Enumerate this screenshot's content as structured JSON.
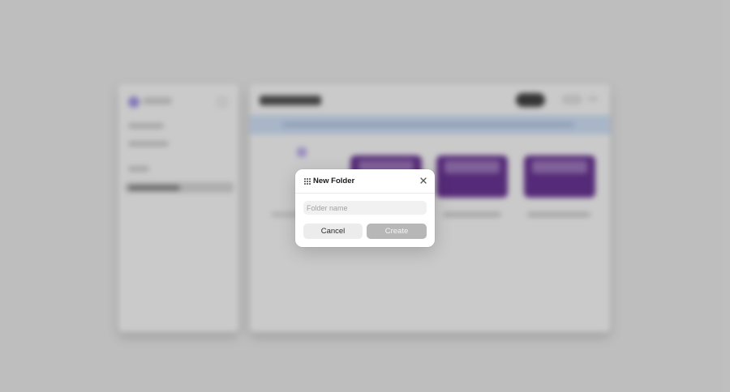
{
  "dialog": {
    "title": "New Folder",
    "input": {
      "placeholder": "Folder name",
      "value": ""
    },
    "cancel_label": "Cancel",
    "create_label": "Create"
  },
  "icons": {
    "drag_handle": "drag-handle-icon",
    "close": "close-icon"
  },
  "colors": {
    "backdrop": "#cfcfcf",
    "dialog_bg": "#ffffff",
    "create_disabled": "#b7b7b7",
    "cancel_bg": "#ececec",
    "card_purple": "#5d2e83"
  }
}
